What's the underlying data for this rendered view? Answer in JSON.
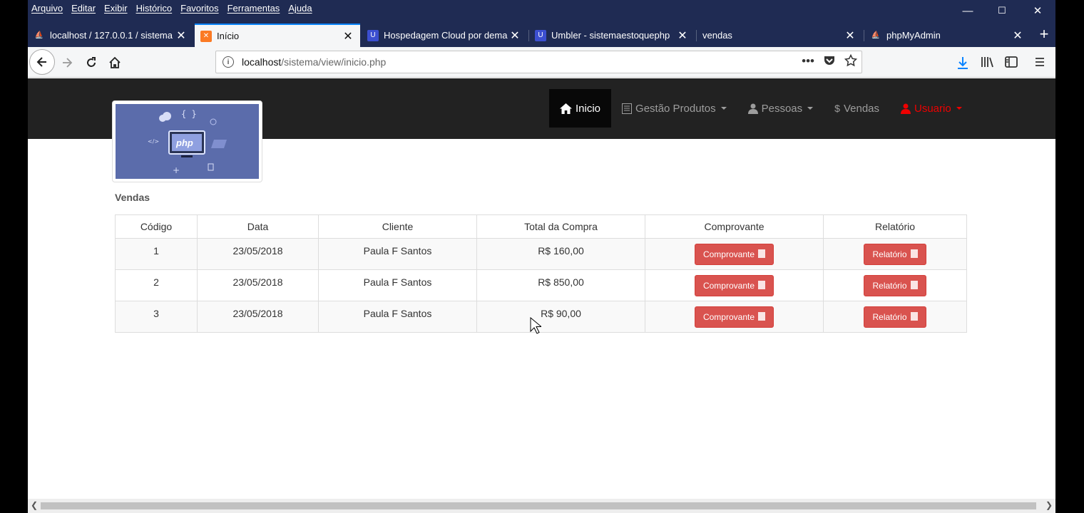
{
  "menubar": {
    "items": [
      "Arquivo",
      "Editar",
      "Exibir",
      "Histórico",
      "Favoritos",
      "Ferramentas",
      "Ajuda"
    ],
    "controls": {
      "minimize": "—",
      "maximize": "☐",
      "close": "✕"
    }
  },
  "tabs": [
    {
      "title": "localhost / 127.0.0.1 / sistema",
      "icon": "phpmyadmin-icon"
    },
    {
      "title": "Início",
      "icon": "xampp-icon"
    },
    {
      "title": "Hospedagem Cloud por dema",
      "icon": "umbler-icon"
    },
    {
      "title": "Umbler - sistemaestoquephp",
      "icon": "umbler-icon"
    },
    {
      "title": "vendas",
      "icon": ""
    },
    {
      "title": "phpMyAdmin",
      "icon": "phpmyadmin-icon"
    }
  ],
  "tab_close": "✕",
  "new_tab": "+",
  "url": {
    "host": "localhost",
    "path": "/sistema/view/inicio.php"
  },
  "site_nav": {
    "items": [
      {
        "label": "Inicio",
        "icon": "home-icon"
      },
      {
        "label": "Gestão Produtos",
        "icon": "list-icon"
      },
      {
        "label": "Pessoas",
        "icon": "user-icon"
      },
      {
        "label": "Vendas",
        "icon": "dollar-icon"
      },
      {
        "label": "Usuario",
        "icon": "user-icon"
      }
    ],
    "dollar": "$"
  },
  "logo_text": "php",
  "section_title": "Vendas",
  "table": {
    "headers": [
      "Código",
      "Data",
      "Cliente",
      "Total da Compra",
      "Comprovante",
      "Relatório"
    ],
    "rows": [
      {
        "codigo": "1",
        "data": "23/05/2018",
        "cliente": "Paula F Santos",
        "total": "R$ 160,00",
        "comprovante": "Comprovante",
        "relatorio": "Relatório"
      },
      {
        "codigo": "2",
        "data": "23/05/2018",
        "cliente": "Paula F Santos",
        "total": "R$ 850,00",
        "comprovante": "Comprovante",
        "relatorio": "Relatório"
      },
      {
        "codigo": "3",
        "data": "23/05/2018",
        "cliente": "Paula F Santos",
        "total": "R$ 90,00",
        "comprovante": "Comprovante",
        "relatorio": "Relatório"
      }
    ]
  },
  "colors": {
    "nav_bg": "#222222",
    "button_red": "#d9534f",
    "user_red": "#ee0000",
    "chrome_bg": "#1f2b53"
  }
}
